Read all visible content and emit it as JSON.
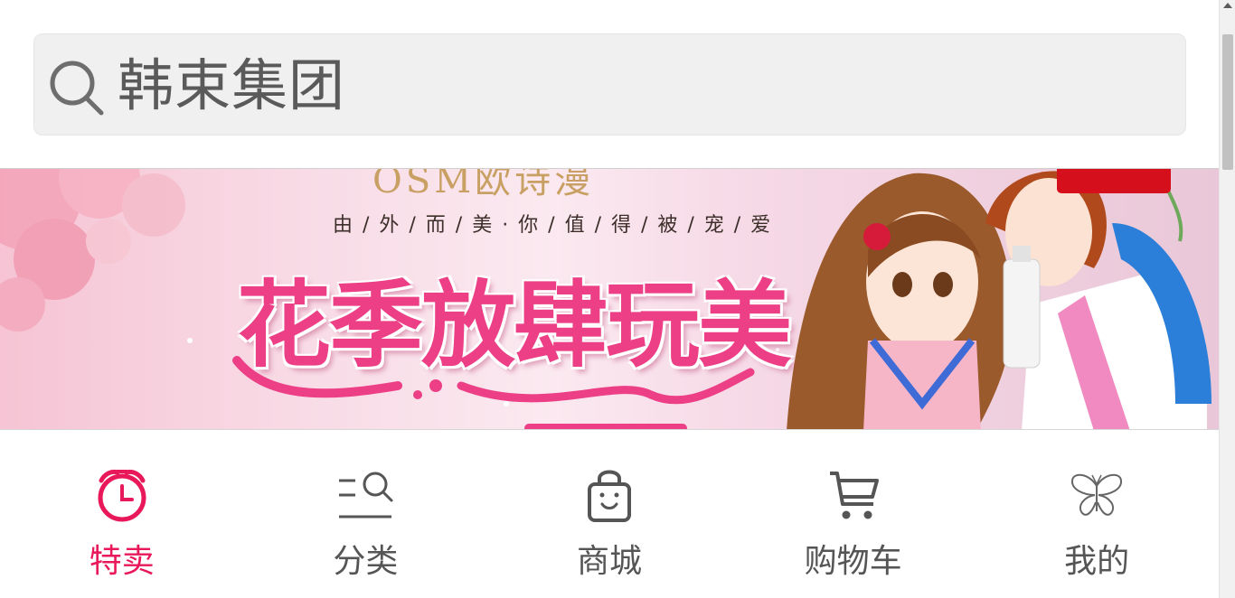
{
  "search": {
    "text": "韩束集团",
    "icon": "search-icon"
  },
  "banner": {
    "brand": "OSM欧诗漫",
    "slogan": "由 / 外 / 而 / 美 · 你 / 值 / 得 / 被 / 宠 / 爱",
    "headline": "花季放肆玩美"
  },
  "tabs": [
    {
      "label": "特卖",
      "icon": "alarm-clock-icon",
      "active": true
    },
    {
      "label": "分类",
      "icon": "category-search-icon",
      "active": false
    },
    {
      "label": "商城",
      "icon": "shopping-bag-icon",
      "active": false
    },
    {
      "label": "购物车",
      "icon": "cart-icon",
      "active": false
    },
    {
      "label": "我的",
      "icon": "butterfly-icon",
      "active": false
    }
  ],
  "colors": {
    "accent": "#e8185a",
    "tab_inactive": "#555555",
    "search_bg": "#f0f0f0"
  }
}
